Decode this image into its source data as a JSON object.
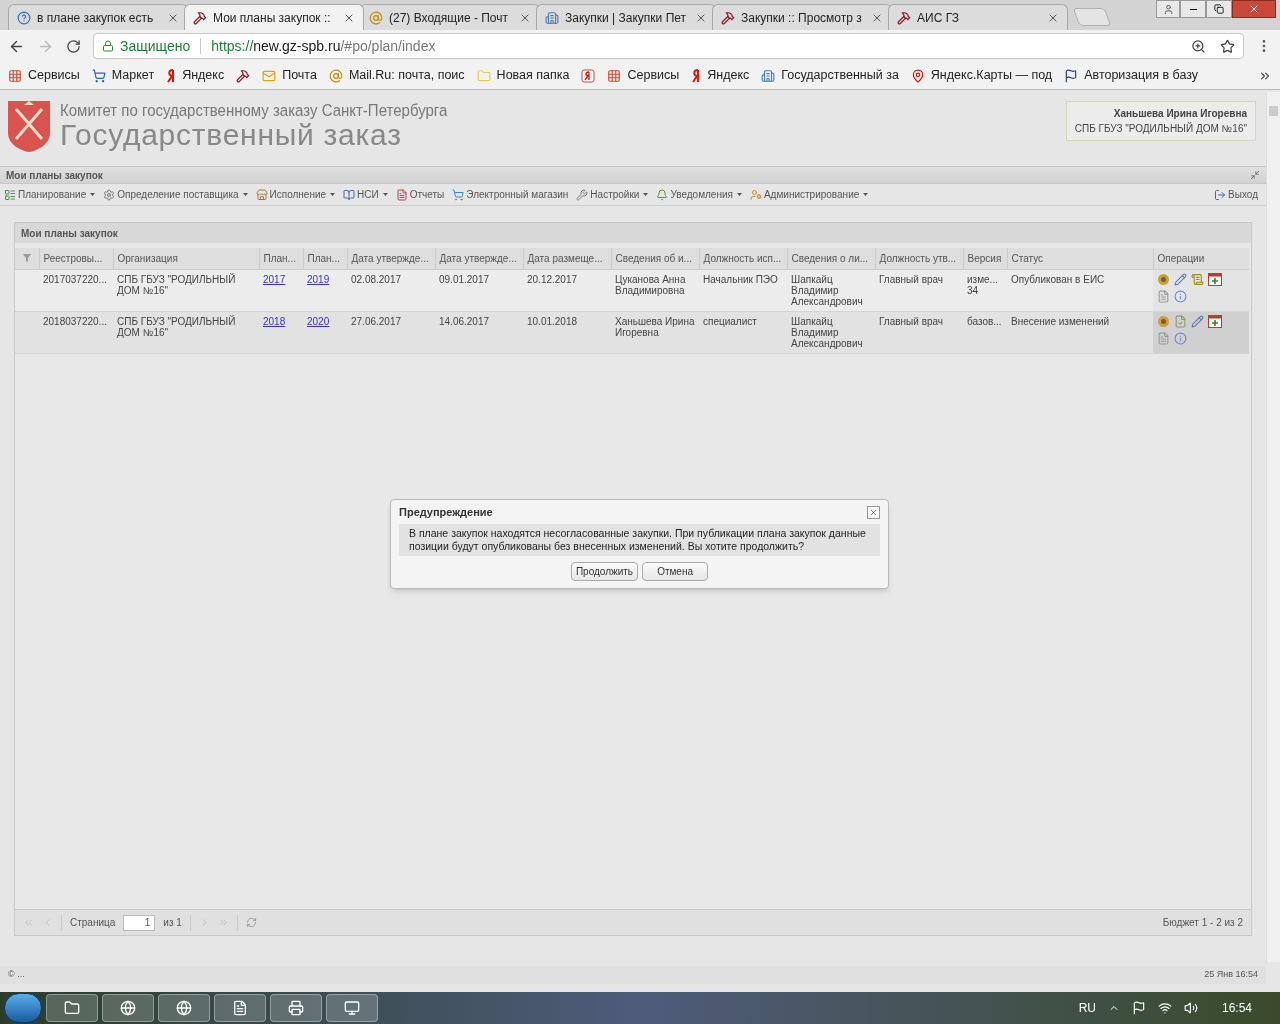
{
  "browser": {
    "tabs": [
      {
        "title": "в плане закупок есть",
        "kind": "help",
        "selected": false
      },
      {
        "title": "Мои планы закупок ::",
        "kind": "hammer",
        "selected": true
      },
      {
        "title": "(27) Входящие - Почт",
        "kind": "at",
        "selected": false
      },
      {
        "title": "Закупки | Закупки Пет",
        "kind": "site",
        "selected": false
      },
      {
        "title": "Закупки :: Просмотр з",
        "kind": "hammer",
        "selected": false
      },
      {
        "title": "АИС ГЗ",
        "kind": "hammer",
        "selected": false
      }
    ],
    "address": {
      "security": "Защищено",
      "scheme": "https://",
      "host": "new.gz-spb.ru",
      "path": "/#po/plan/index"
    },
    "bookmarks": [
      {
        "label": "Сервисы",
        "kind": "apps"
      },
      {
        "label": "Маркет",
        "kind": "cart"
      },
      {
        "label": "Яндекс",
        "kind": "yandex"
      },
      {
        "kind": "hammer"
      },
      {
        "label": "Почта",
        "kind": "mail"
      },
      {
        "label": "Mail.Ru: почта, поис",
        "kind": "at"
      },
      {
        "label": "Новая папка",
        "kind": "folder"
      },
      {
        "kind": "yandex-box"
      },
      {
        "label": "Сервисы",
        "kind": "apps"
      },
      {
        "label": "Яндекс",
        "kind": "yandex"
      },
      {
        "label": "Государственный за",
        "kind": "site"
      },
      {
        "label": "Яндекс.Карты — под",
        "kind": "pin"
      },
      {
        "label": "Авторизация в базу",
        "kind": "flag"
      }
    ]
  },
  "header": {
    "org": "Комитет по государственному заказу Санкт-Петербурга",
    "title": "Государственный заказ",
    "user": {
      "name": "Ханьшева Ирина Игоревна",
      "org": "СПБ ГБУЗ \"РОДИЛЬНЫЙ ДОМ №16\""
    }
  },
  "panel": {
    "title": "Мои планы закупок",
    "exit": "Выход"
  },
  "menu": [
    {
      "label": "Планирование",
      "dropdown": true
    },
    {
      "label": "Определение поставщика",
      "dropdown": true
    },
    {
      "label": "Исполнение",
      "dropdown": true
    },
    {
      "label": "НСИ",
      "dropdown": true
    },
    {
      "label": "Отчеты",
      "dropdown": false
    },
    {
      "label": "Электронный магазин",
      "dropdown": false
    },
    {
      "label": "Настройки",
      "dropdown": true
    },
    {
      "label": "Уведомления",
      "dropdown": true
    },
    {
      "label": "Администрирование",
      "dropdown": true
    }
  ],
  "grid": {
    "title": "Мои планы закупок",
    "columns": [
      {
        "label": "Реестровы...",
        "kind": "text"
      },
      {
        "label": "Организация",
        "kind": "text"
      },
      {
        "label": "План...",
        "kind": "link"
      },
      {
        "label": "План...",
        "kind": "link"
      },
      {
        "label": "Дата утвержде...",
        "kind": "text"
      },
      {
        "label": "Дата утвержде...",
        "kind": "text"
      },
      {
        "label": "Дата размеще...",
        "kind": "text"
      },
      {
        "label": "Сведения об и...",
        "kind": "text"
      },
      {
        "label": "Должность исп...",
        "kind": "text"
      },
      {
        "label": "Сведения о ли...",
        "kind": "text"
      },
      {
        "label": "Должность утв...",
        "kind": "text"
      },
      {
        "label": "Версия",
        "kind": "text"
      },
      {
        "label": "Статус",
        "kind": "text"
      }
    ],
    "operations_label": "Операции",
    "rows": [
      {
        "selected": false,
        "cells": [
          "2017037220...",
          "СПБ ГБУЗ \"РОДИЛЬНЫЙ ДОМ №16\"",
          "2017",
          "2019",
          "02.08.2017",
          "09.01.2017",
          "20.12.2017",
          "Цуканова Анна Владимировна",
          "Начальник ПЭО",
          "Шапкайц Владимир Александрович",
          "Главный врач",
          "изме... 34",
          "Опубликован в ЕИС"
        ],
        "kind": "published"
      },
      {
        "selected": true,
        "cells": [
          "2018037220...",
          "СПБ ГБУЗ \"РОДИЛЬНЫЙ ДОМ №16\"",
          "2018",
          "2020",
          "27.06.2017",
          "14.06.2017",
          "10.01.2018",
          "Ханьшева Ирина Игоревна",
          "специалист",
          "Шапкайц Владимир Александрович",
          "Главный врач",
          "базов...",
          "Внесение изменений"
        ],
        "kind": "draft"
      }
    ],
    "pager": {
      "page_label": "Страница",
      "page": "1",
      "of": "из 1",
      "summary": "Бюджет 1 - 2 из 2"
    }
  },
  "footer": {
    "left": "© ...",
    "right": "25 Янв 16:54"
  },
  "dialog": {
    "title": "Предупреждение",
    "message": "В плане закупок находятся несогласованные закупки. При публикации плана закупок данные позиции будут опубликованы без внесенных изменений. Вы хотите продолжить?",
    "buttons": [
      "Продолжить",
      "Отмена"
    ]
  },
  "taskbar": {
    "lang": "RU",
    "time": "16:54"
  }
}
